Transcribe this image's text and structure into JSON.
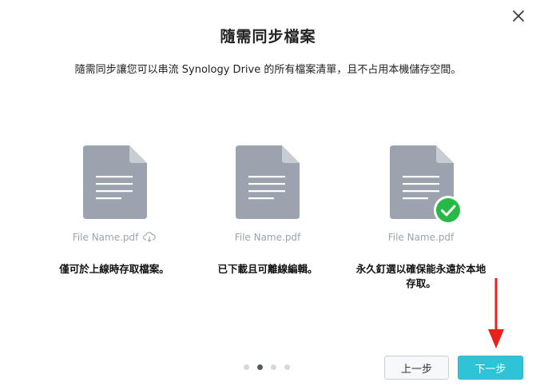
{
  "dialog": {
    "title": "隨需同步檔案",
    "subtitle": "隨需同步讓您可以串流 Synology Drive 的所有檔案清單，且不占用本機儲存空間。"
  },
  "cards": [
    {
      "file_name": "File Name.pdf",
      "status_icon": "cloud-download-icon",
      "description": "僅可於上線時存取檔案。"
    },
    {
      "file_name": "File Name.pdf",
      "status_icon": "none",
      "description": "已下載且可離線編輯。"
    },
    {
      "file_name": "File Name.pdf",
      "status_icon": "check-circle-icon",
      "description": "永久釘選以確保能永遠於本地存取。"
    }
  ],
  "pagination": {
    "total": 4,
    "current": 2
  },
  "buttons": {
    "prev_label": "上一步",
    "next_label": "下一步"
  },
  "colors": {
    "accent": "#2ec4d8",
    "doc_icon": "#9aa3ae",
    "check_badge": "#27b945",
    "annotation_arrow": "#e8221b"
  }
}
